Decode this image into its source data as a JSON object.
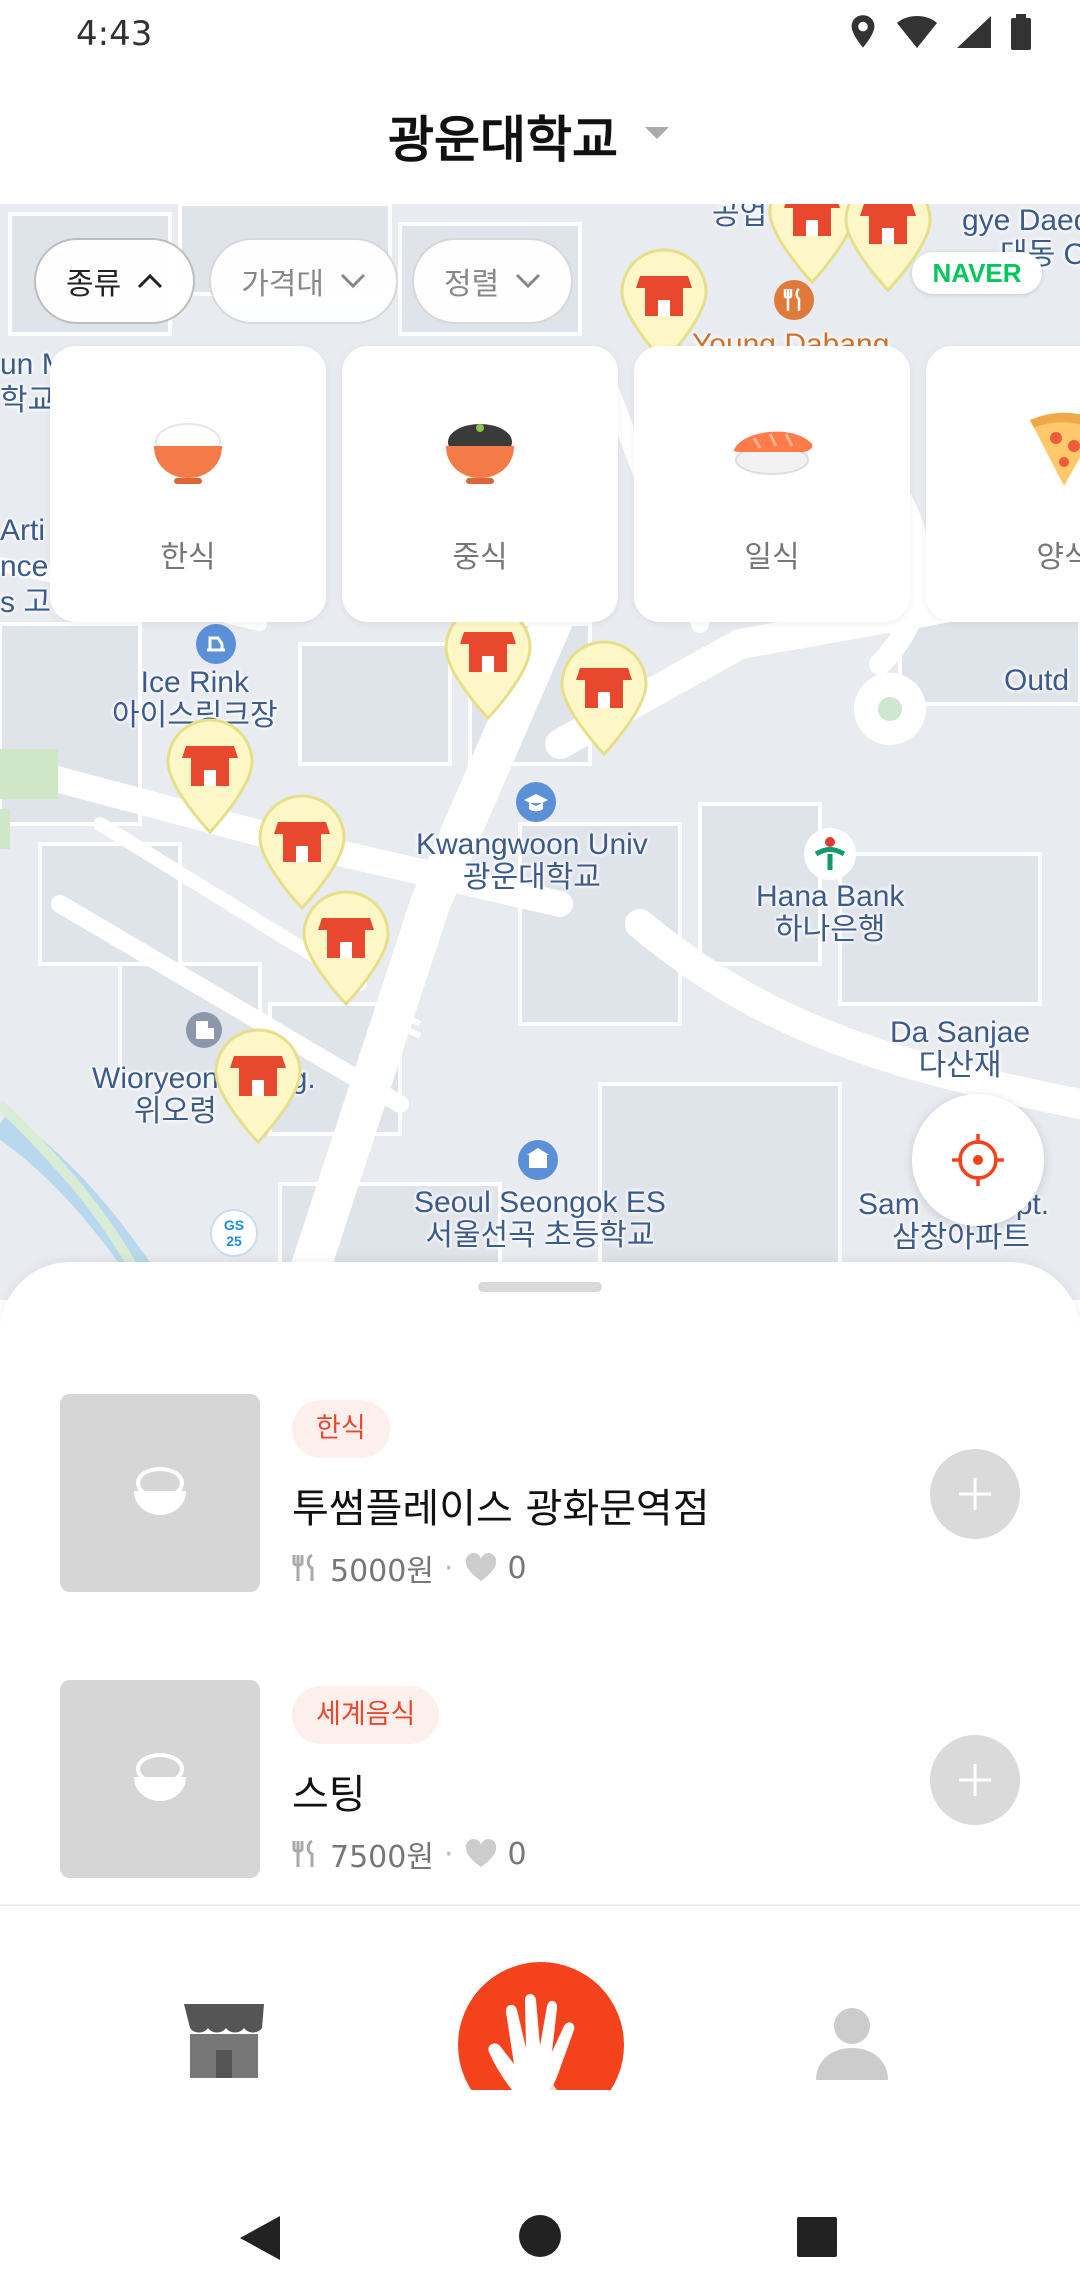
{
  "status_bar": {
    "time": "4:43",
    "icons": [
      "location-icon",
      "wifi-icon",
      "signal-icon",
      "battery-icon"
    ]
  },
  "header": {
    "title": "광운대학교"
  },
  "filters": [
    {
      "label": "종류",
      "state": "expanded"
    },
    {
      "label": "가격대",
      "state": "collapsed"
    },
    {
      "label": "정렬",
      "state": "collapsed"
    }
  ],
  "categories": [
    {
      "label": "한식",
      "icon": "rice-bowl-icon"
    },
    {
      "label": "중식",
      "icon": "noodle-bowl-icon"
    },
    {
      "label": "일식",
      "icon": "sushi-icon"
    },
    {
      "label": "양식",
      "icon": "pizza-icon"
    }
  ],
  "map": {
    "provider_logo": "NAVER",
    "labels": {
      "ice_rink_en": "Ice Rink",
      "ice_rink_ko": "아이스링크장",
      "kw_en": "Kwangwoon Univ",
      "kw_ko": "광운대학교",
      "hana_en": "Hana Bank",
      "hana_ko": "하나은행",
      "dasanjae_en": "Da Sanjae",
      "dasanjae_ko": "다산재",
      "wioryeong_en": "Wioryeon",
      "wioryeong_en2": "g.",
      "wioryeong_ko": "위오령",
      "seongok_en": "Seoul Seongok ES",
      "seongok_ko": "서울선곡 초등학교",
      "samchang_en": "Sam",
      "samchang_en2": "pt.",
      "samchang_ko": "삼창아파트",
      "young_dabang": "Young Dabang",
      "outd": "Outd",
      "left_un": "un M",
      "left_gyo": "학교",
      "left_arti": "Arti",
      "left_nce": "nce",
      "left_go": "s 고등",
      "top_gong": "공업",
      "top_gye": "gye Daed",
      "top_dong": "대동 C",
      "gs25": "GS 25"
    }
  },
  "restaurants": [
    {
      "category": "한식",
      "name": "투썸플레이스 광화문역점",
      "price": "5000원",
      "likes": "0"
    },
    {
      "category": "세계음식",
      "name": "스팅",
      "price": "7500원",
      "likes": "0"
    }
  ],
  "colors": {
    "accent": "#f4421d",
    "tag_bg": "#fdf0ec",
    "tag_text": "#e8492e",
    "marker_fill": "#fdf7c8",
    "marker_store": "#e8492e",
    "naver_green": "#03c75a"
  }
}
